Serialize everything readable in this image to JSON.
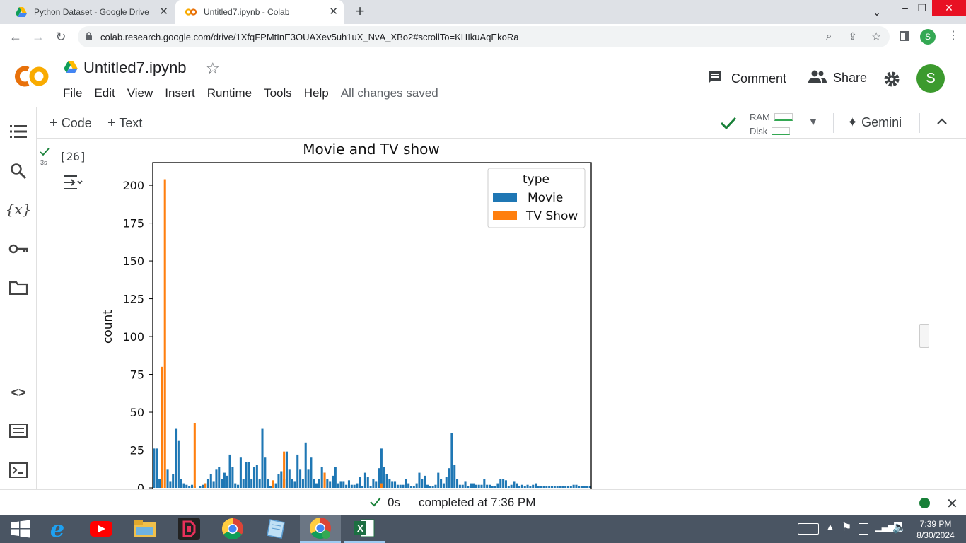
{
  "browser": {
    "tabs": [
      {
        "title": "Python Dataset - Google Drive",
        "active": false
      },
      {
        "title": "Untitled7.ipynb - Colab",
        "active": true
      }
    ],
    "new_tab": "+",
    "url": "colab.research.google.com/drive/1XfqFPMtInE3OUAXev5uh1uX_NvA_XBo2#scrollTo=KHIkuAqEkoRa",
    "profile_initial": "S"
  },
  "colab": {
    "logo": "CO",
    "notebook_title": "Untitled7.ipynb",
    "menu": [
      "File",
      "Edit",
      "View",
      "Insert",
      "Runtime",
      "Tools",
      "Help"
    ],
    "save_status": "All changes saved",
    "comment_label": "Comment",
    "share_label": "Share",
    "avatar_initial": "S",
    "toolbar": {
      "code_label": "Code",
      "text_label": "Text",
      "ram_label": "RAM",
      "disk_label": "Disk",
      "gemini_label": "Gemini"
    },
    "cell": {
      "exec_count": "[26]",
      "exec_time": "3s"
    }
  },
  "chart_data": {
    "type": "bar",
    "title": "Movie and TV show",
    "xlabel": "",
    "ylabel": "count",
    "ylim": [
      0,
      215
    ],
    "yticks": [
      0,
      25,
      50,
      75,
      100,
      125,
      150,
      175,
      200
    ],
    "legend_title": "type",
    "legend_position": "top-right",
    "series": [
      {
        "name": "Movie",
        "color": "#1f77b4",
        "values": [
          26,
          26,
          6,
          0,
          0,
          12,
          4,
          9,
          39,
          31,
          6,
          3,
          2,
          1,
          2,
          1,
          0,
          1,
          2,
          3,
          6,
          9,
          4,
          12,
          14,
          6,
          10,
          8,
          22,
          14,
          3,
          2,
          20,
          6,
          17,
          17,
          6,
          14,
          15,
          6,
          39,
          20,
          6,
          1,
          1,
          3,
          9,
          11,
          6,
          24,
          12,
          6,
          4,
          22,
          12,
          6,
          30,
          12,
          20,
          6,
          3,
          6,
          14,
          10,
          6,
          4,
          8,
          14,
          3,
          4,
          4,
          2,
          5,
          2,
          2,
          3,
          7,
          1,
          10,
          7,
          1,
          6,
          4,
          13,
          26,
          14,
          9,
          6,
          4,
          4,
          2,
          2,
          2,
          6,
          3,
          1,
          1,
          3,
          10,
          6,
          8,
          2,
          1,
          1,
          2,
          10,
          6,
          3,
          7,
          13,
          36,
          15,
          6,
          2,
          2,
          4,
          1,
          3,
          3,
          2,
          2,
          2,
          6,
          2,
          2,
          1,
          1,
          3,
          6,
          6,
          5,
          1,
          2,
          4,
          3,
          1,
          2,
          1,
          2,
          1,
          2,
          3,
          1,
          1,
          1,
          1,
          1,
          1,
          1,
          1,
          1,
          1,
          1,
          1,
          1,
          2,
          2,
          1,
          1,
          1,
          1,
          1
        ]
      },
      {
        "name": "TV Show",
        "color": "#ff7f0e",
        "values": [
          0,
          0,
          0,
          80,
          204,
          0,
          0,
          0,
          0,
          0,
          0,
          0,
          0,
          0,
          0,
          43,
          0,
          0,
          0,
          0,
          0,
          0,
          0,
          0,
          0,
          0,
          0,
          0,
          0,
          0,
          0,
          0,
          0,
          0,
          0,
          0,
          0,
          0,
          0,
          0,
          0,
          0,
          0,
          0,
          0,
          0,
          0,
          0,
          0,
          0,
          0,
          0,
          0,
          0,
          0,
          0,
          0,
          0,
          0,
          0,
          0,
          0,
          0,
          0,
          0,
          0,
          0,
          0,
          0,
          0,
          0,
          0,
          0,
          0,
          0,
          0,
          0,
          0,
          0,
          0,
          0,
          0,
          0,
          0,
          0,
          0,
          0,
          0,
          0,
          0,
          0,
          0,
          0,
          0,
          0,
          0,
          0,
          0,
          0,
          0,
          0,
          0,
          0,
          0,
          0,
          0,
          0,
          0,
          0,
          0,
          0,
          0,
          0,
          0,
          0,
          0,
          0,
          0,
          0,
          0,
          0,
          0,
          0,
          0,
          0,
          0,
          0,
          0,
          0,
          0,
          0,
          0,
          0,
          0,
          0,
          0,
          0,
          0,
          0,
          0,
          0,
          0,
          0,
          0,
          0,
          0,
          0,
          0,
          0,
          0,
          0,
          0,
          0,
          0,
          0,
          0,
          0,
          0,
          0,
          0,
          0
        ]
      }
    ],
    "extra_tv_marks": [
      {
        "index": 48,
        "value": 24
      },
      {
        "index": 44,
        "value": 5
      },
      {
        "index": 63,
        "value": 10
      },
      {
        "index": 84,
        "value": 3
      },
      {
        "index": 19,
        "value": 3
      }
    ]
  },
  "statusbar": {
    "elapsed": "0s",
    "completed": "completed at 7:36 PM"
  },
  "taskbar": {
    "time": "7:39 PM",
    "date": "8/30/2024"
  },
  "colors": {
    "colab_orange": "#f9ab00",
    "colab_orange_dark": "#e8710a",
    "avatar_green": "#34a853",
    "taskbar": "#4a5563"
  },
  "icons": [
    "google-drive-icon",
    "colab-icon",
    "back-icon",
    "forward-icon",
    "reload-icon",
    "lock-icon",
    "zoom-icon",
    "share-page-icon",
    "star-icon",
    "sidepanel-icon",
    "comment-icon",
    "people-icon",
    "gear-icon",
    "check-icon",
    "chevron-down-icon",
    "gemini-sparkle-icon",
    "chevron-up-icon",
    "toc-icon",
    "search-icon",
    "variables-icon",
    "key-icon",
    "folder-icon",
    "code-snippets-icon",
    "command-palette-icon",
    "terminal-icon",
    "output-toggle-icon",
    "close-icon"
  ]
}
